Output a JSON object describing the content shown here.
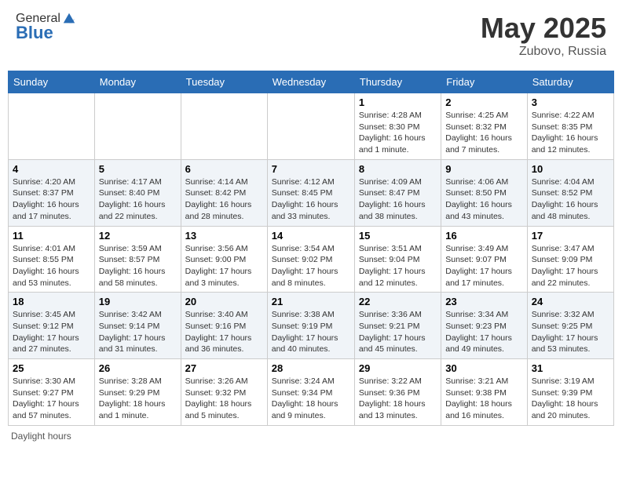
{
  "header": {
    "logo_general": "General",
    "logo_blue": "Blue",
    "month_year": "May 2025",
    "location": "Zubovo, Russia"
  },
  "weekdays": [
    "Sunday",
    "Monday",
    "Tuesday",
    "Wednesday",
    "Thursday",
    "Friday",
    "Saturday"
  ],
  "footer": {
    "note": "Daylight hours"
  },
  "weeks": [
    [
      {
        "day": "",
        "info": ""
      },
      {
        "day": "",
        "info": ""
      },
      {
        "day": "",
        "info": ""
      },
      {
        "day": "",
        "info": ""
      },
      {
        "day": "1",
        "info": "Sunrise: 4:28 AM\nSunset: 8:30 PM\nDaylight: 16 hours\nand 1 minute."
      },
      {
        "day": "2",
        "info": "Sunrise: 4:25 AM\nSunset: 8:32 PM\nDaylight: 16 hours\nand 7 minutes."
      },
      {
        "day": "3",
        "info": "Sunrise: 4:22 AM\nSunset: 8:35 PM\nDaylight: 16 hours\nand 12 minutes."
      }
    ],
    [
      {
        "day": "4",
        "info": "Sunrise: 4:20 AM\nSunset: 8:37 PM\nDaylight: 16 hours\nand 17 minutes."
      },
      {
        "day": "5",
        "info": "Sunrise: 4:17 AM\nSunset: 8:40 PM\nDaylight: 16 hours\nand 22 minutes."
      },
      {
        "day": "6",
        "info": "Sunrise: 4:14 AM\nSunset: 8:42 PM\nDaylight: 16 hours\nand 28 minutes."
      },
      {
        "day": "7",
        "info": "Sunrise: 4:12 AM\nSunset: 8:45 PM\nDaylight: 16 hours\nand 33 minutes."
      },
      {
        "day": "8",
        "info": "Sunrise: 4:09 AM\nSunset: 8:47 PM\nDaylight: 16 hours\nand 38 minutes."
      },
      {
        "day": "9",
        "info": "Sunrise: 4:06 AM\nSunset: 8:50 PM\nDaylight: 16 hours\nand 43 minutes."
      },
      {
        "day": "10",
        "info": "Sunrise: 4:04 AM\nSunset: 8:52 PM\nDaylight: 16 hours\nand 48 minutes."
      }
    ],
    [
      {
        "day": "11",
        "info": "Sunrise: 4:01 AM\nSunset: 8:55 PM\nDaylight: 16 hours\nand 53 minutes."
      },
      {
        "day": "12",
        "info": "Sunrise: 3:59 AM\nSunset: 8:57 PM\nDaylight: 16 hours\nand 58 minutes."
      },
      {
        "day": "13",
        "info": "Sunrise: 3:56 AM\nSunset: 9:00 PM\nDaylight: 17 hours\nand 3 minutes."
      },
      {
        "day": "14",
        "info": "Sunrise: 3:54 AM\nSunset: 9:02 PM\nDaylight: 17 hours\nand 8 minutes."
      },
      {
        "day": "15",
        "info": "Sunrise: 3:51 AM\nSunset: 9:04 PM\nDaylight: 17 hours\nand 12 minutes."
      },
      {
        "day": "16",
        "info": "Sunrise: 3:49 AM\nSunset: 9:07 PM\nDaylight: 17 hours\nand 17 minutes."
      },
      {
        "day": "17",
        "info": "Sunrise: 3:47 AM\nSunset: 9:09 PM\nDaylight: 17 hours\nand 22 minutes."
      }
    ],
    [
      {
        "day": "18",
        "info": "Sunrise: 3:45 AM\nSunset: 9:12 PM\nDaylight: 17 hours\nand 27 minutes."
      },
      {
        "day": "19",
        "info": "Sunrise: 3:42 AM\nSunset: 9:14 PM\nDaylight: 17 hours\nand 31 minutes."
      },
      {
        "day": "20",
        "info": "Sunrise: 3:40 AM\nSunset: 9:16 PM\nDaylight: 17 hours\nand 36 minutes."
      },
      {
        "day": "21",
        "info": "Sunrise: 3:38 AM\nSunset: 9:19 PM\nDaylight: 17 hours\nand 40 minutes."
      },
      {
        "day": "22",
        "info": "Sunrise: 3:36 AM\nSunset: 9:21 PM\nDaylight: 17 hours\nand 45 minutes."
      },
      {
        "day": "23",
        "info": "Sunrise: 3:34 AM\nSunset: 9:23 PM\nDaylight: 17 hours\nand 49 minutes."
      },
      {
        "day": "24",
        "info": "Sunrise: 3:32 AM\nSunset: 9:25 PM\nDaylight: 17 hours\nand 53 minutes."
      }
    ],
    [
      {
        "day": "25",
        "info": "Sunrise: 3:30 AM\nSunset: 9:27 PM\nDaylight: 17 hours\nand 57 minutes."
      },
      {
        "day": "26",
        "info": "Sunrise: 3:28 AM\nSunset: 9:29 PM\nDaylight: 18 hours\nand 1 minute."
      },
      {
        "day": "27",
        "info": "Sunrise: 3:26 AM\nSunset: 9:32 PM\nDaylight: 18 hours\nand 5 minutes."
      },
      {
        "day": "28",
        "info": "Sunrise: 3:24 AM\nSunset: 9:34 PM\nDaylight: 18 hours\nand 9 minutes."
      },
      {
        "day": "29",
        "info": "Sunrise: 3:22 AM\nSunset: 9:36 PM\nDaylight: 18 hours\nand 13 minutes."
      },
      {
        "day": "30",
        "info": "Sunrise: 3:21 AM\nSunset: 9:38 PM\nDaylight: 18 hours\nand 16 minutes."
      },
      {
        "day": "31",
        "info": "Sunrise: 3:19 AM\nSunset: 9:39 PM\nDaylight: 18 hours\nand 20 minutes."
      }
    ]
  ]
}
